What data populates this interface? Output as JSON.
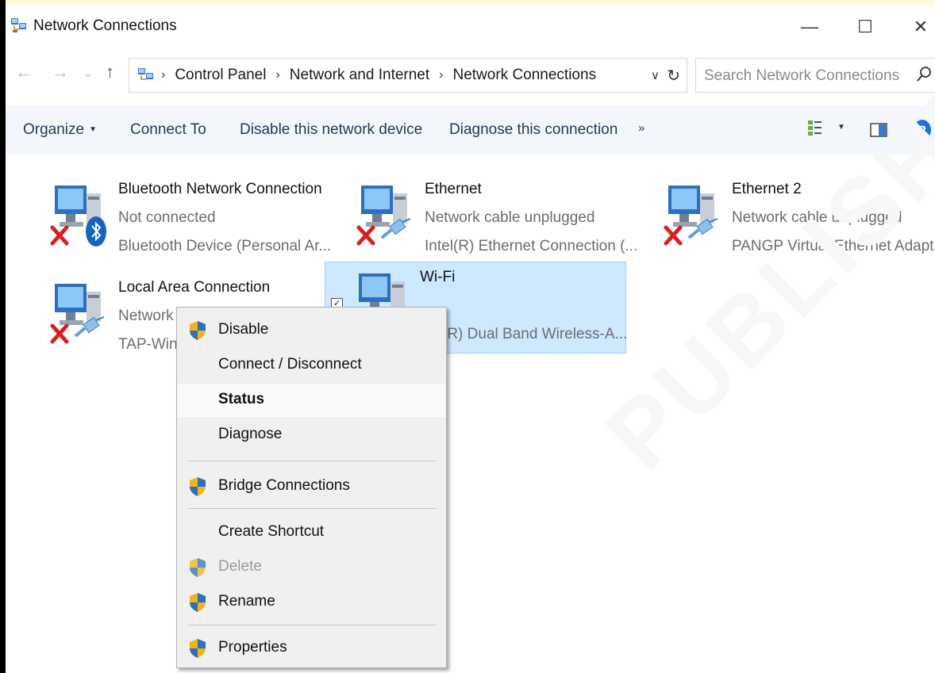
{
  "window": {
    "title": "Network Connections",
    "controls": {
      "minimize": "—",
      "maximize": "☐",
      "close": "✕"
    }
  },
  "address": {
    "crumbs": [
      "Control Panel",
      "Network and Internet",
      "Network Connections"
    ],
    "separator": "›",
    "back": "←",
    "forward": "→",
    "recent": "⌄",
    "up": "↑",
    "dropdown": "∨",
    "refresh": "↻"
  },
  "search": {
    "placeholder": "Search Network Connections"
  },
  "commandbar": {
    "organize": "Organize",
    "connect_to": "Connect To",
    "disable": "Disable this network device",
    "diagnose": "Diagnose this connection",
    "more": "»"
  },
  "connections": [
    {
      "name": "Bluetooth Network Connection",
      "status": "Not connected",
      "device": "Bluetooth Device (Personal Ar...",
      "overlay": "bluetooth",
      "disconnected": true
    },
    {
      "name": "Ethernet",
      "status": "Network cable unplugged",
      "device": "Intel(R) Ethernet Connection (...",
      "overlay": "cable",
      "disconnected": true
    },
    {
      "name": "Ethernet 2",
      "status": "Network cable unplugged",
      "device": "PANGP Virtual Ethernet Adapt...",
      "overlay": "cable",
      "disconnected": true
    },
    {
      "name": "Local Area Connection",
      "status": "Network c",
      "device": "TAP-Wind",
      "overlay": "cable",
      "disconnected": true
    },
    {
      "name": "Wi-Fi",
      "status": "",
      "device": "(R) Dual Band Wireless-A...",
      "overlay": "none",
      "selected": true,
      "checkbox": "✓"
    }
  ],
  "context_menu": {
    "items": [
      {
        "label": "Disable",
        "shield": true
      },
      {
        "label": "Connect / Disconnect"
      },
      {
        "label": "Status",
        "default": true,
        "highlighted": true
      },
      {
        "label": "Diagnose"
      },
      {
        "label": "Bridge Connections",
        "shield": true
      },
      {
        "label": "Create Shortcut"
      },
      {
        "label": "Delete",
        "shield": true,
        "disabled": true
      },
      {
        "label": "Rename",
        "shield": true
      },
      {
        "label": "Properties",
        "shield": true
      }
    ]
  },
  "colors": {
    "selection": "#cde8ff",
    "command_text": "#1e395b",
    "command_bg": "#f3f6fb",
    "menu_bg": "#f0f0f0"
  },
  "watermark": "PUBLISHED"
}
